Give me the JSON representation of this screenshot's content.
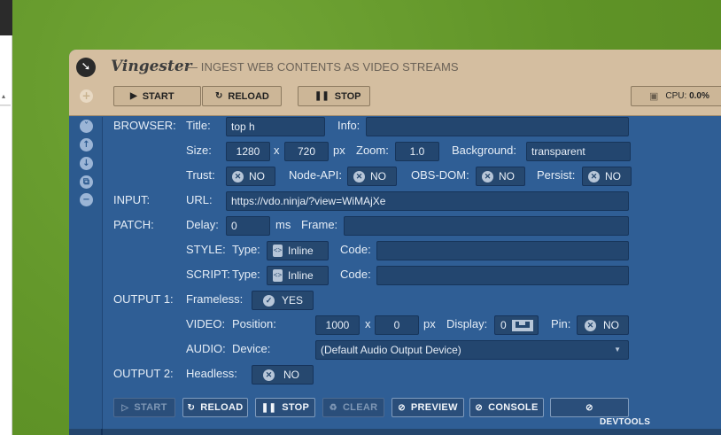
{
  "app": {
    "title": "Vingester",
    "subtitle": "— INGEST WEB CONTENTS AS VIDEO STREAMS",
    "logo_icon": "arrow-down-right-icon"
  },
  "header": {
    "start_label": "START",
    "reload_label": "RELOAD",
    "stop_label": "STOP",
    "cpu_label": "CPU:",
    "cpu_value": "0.0%"
  },
  "browser": {
    "section_label": "BROWSER:",
    "title_label": "Title:",
    "title_value": "top h",
    "info_label": "Info:",
    "info_value": "",
    "size_label": "Size:",
    "width_value": "1280",
    "x_sep": "x",
    "height_value": "720",
    "px_unit": "px",
    "zoom_label": "Zoom:",
    "zoom_value": "1.0",
    "background_label": "Background:",
    "background_value": "transparent",
    "trust_label": "Trust:",
    "trust_value": "NO",
    "nodeapi_label": "Node-API:",
    "nodeapi_value": "NO",
    "obsdom_label": "OBS-DOM:",
    "obsdom_value": "NO",
    "persist_label": "Persist:",
    "persist_value": "NO"
  },
  "input": {
    "section_label": "INPUT:",
    "url_label": "URL:",
    "url_value": "https://vdo.ninja/?view=WiMAjXe"
  },
  "patch": {
    "section_label": "PATCH:",
    "delay_label": "Delay:",
    "delay_value": "0",
    "ms_unit": "ms",
    "frame_label": "Frame:",
    "frame_value": "",
    "style_label": "STYLE:",
    "style_type_label": "Type:",
    "style_type_value": "Inline",
    "style_code_label": "Code:",
    "style_code_value": "",
    "script_label": "SCRIPT:",
    "script_type_label": "Type:",
    "script_type_value": "Inline",
    "script_code_label": "Code:",
    "script_code_value": ""
  },
  "output1": {
    "section_label": "OUTPUT 1:",
    "frameless_label": "Frameless:",
    "frameless_value": "YES",
    "video_label": "VIDEO:",
    "position_label": "Position:",
    "pos_x_value": "1000",
    "x_sep": "x",
    "pos_y_value": "0",
    "px_unit": "px",
    "display_label": "Display:",
    "display_value": "0",
    "pin_label": "Pin:",
    "pin_value": "NO",
    "audio_label": "AUDIO:",
    "device_label": "Device:",
    "device_value": "(Default Audio Output Device)"
  },
  "output2": {
    "section_label": "OUTPUT 2:",
    "headless_label": "Headless:",
    "headless_value": "NO"
  },
  "footer": {
    "start_label": "START",
    "reload_label": "RELOAD",
    "stop_label": "STOP",
    "clear_label": "CLEAR",
    "preview_label": "PREVIEW",
    "console_label": "CONSOLE",
    "devtools_label": "DEVTOOLS"
  },
  "colors": {
    "header_bg": "#d4bea0",
    "panel_bg": "#2f5e95",
    "field_bg": "#23466f",
    "desktop_bg": "#64982a"
  }
}
